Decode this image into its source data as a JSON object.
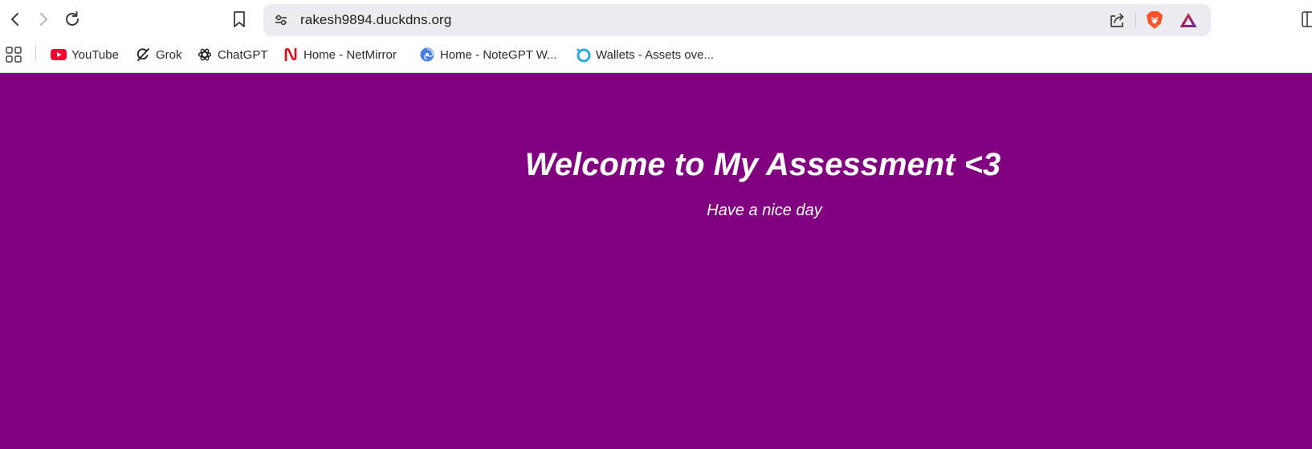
{
  "toolbar": {
    "back_icon": "back-arrow-icon",
    "forward_icon": "forward-arrow-icon",
    "reload_icon": "reload-icon",
    "bookmark_icon": "bookmark-icon",
    "site_settings_icon": "tune-icon",
    "url": "rakesh9894.duckdns.org",
    "share_icon": "share-icon",
    "shield_icon": "brave-shield-icon",
    "rewards_icon": "brave-rewards-icon",
    "colors": {
      "address_bar_bg": "#ecebf0",
      "shield": "#fb542b"
    }
  },
  "bookmarks": {
    "apps_icon": "apps-grid-icon",
    "items": [
      {
        "label": "YouTube",
        "icon": "youtube-icon"
      },
      {
        "label": "Grok",
        "icon": "grok-icon"
      },
      {
        "label": "ChatGPT",
        "icon": "chatgpt-icon"
      },
      {
        "label": "Home - NetMirror",
        "icon": "netmirror-icon"
      },
      {
        "label": "Home - NoteGPT W...",
        "icon": "notegpt-icon"
      },
      {
        "label": "Wallets - Assets ove...",
        "icon": "wallet-icon"
      }
    ]
  },
  "page": {
    "background_color": "#800080",
    "headline": "Welcome to My Assessment <3",
    "subline": "Have a nice day"
  }
}
